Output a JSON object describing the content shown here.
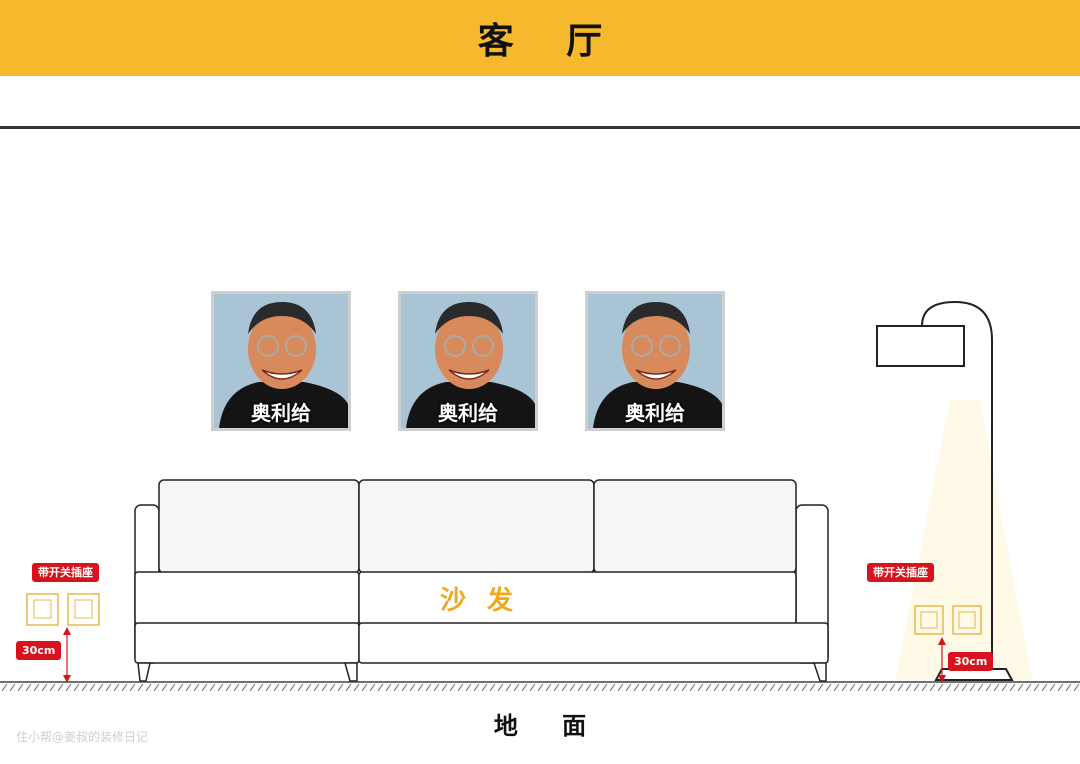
{
  "header": {
    "title": "客 厅"
  },
  "frames": [
    {
      "caption": "奥利给"
    },
    {
      "caption": "奥利给"
    },
    {
      "caption": "奥利给"
    }
  ],
  "sofa": {
    "label": "沙 发"
  },
  "outlets": {
    "left": {
      "tag": "带开关插座",
      "height": "30cm"
    },
    "right": {
      "tag": "带开关插座",
      "height": "30cm"
    }
  },
  "ground": {
    "left": "地",
    "right": "面"
  },
  "watermark": "住小帮@姜叔的装修日记",
  "colors": {
    "header_bg": "#F6B82C",
    "tag_red": "#D7141E",
    "sofa_label": "#F0A91C"
  },
  "icons": [
    "floor-lamp-icon",
    "outlet-icon",
    "sofa-icon",
    "portrait-photo"
  ]
}
